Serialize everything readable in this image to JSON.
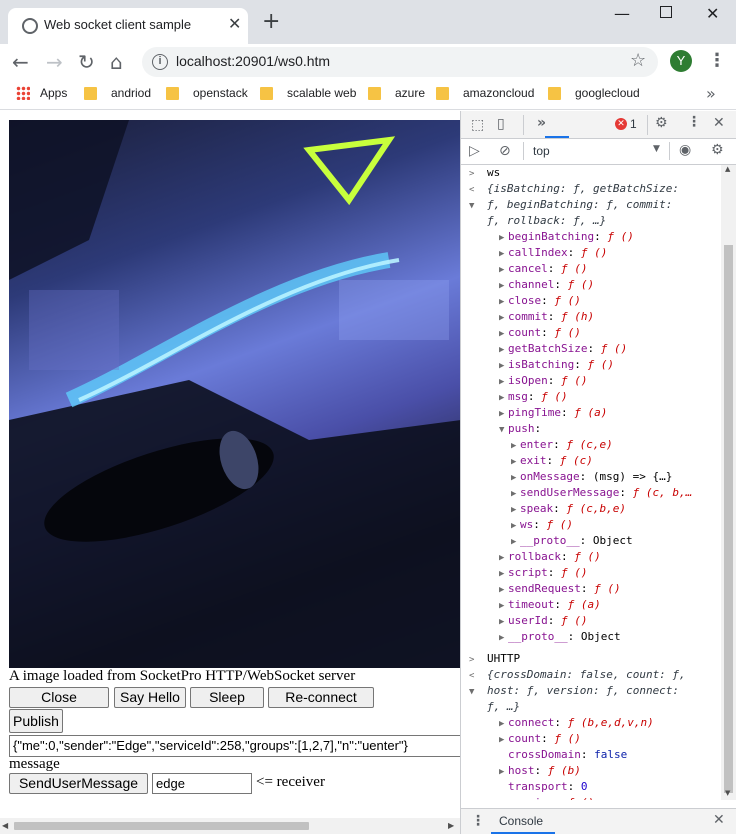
{
  "tab": {
    "title": "Web socket client sample"
  },
  "address": {
    "url": "localhost:20901/ws0.htm"
  },
  "profile": {
    "initial": "Y"
  },
  "bookmarks": [
    {
      "label": "Apps"
    },
    {
      "label": "andriod"
    },
    {
      "label": "openstack"
    },
    {
      "label": "scalable web"
    },
    {
      "label": "azure"
    },
    {
      "label": "amazoncloud"
    },
    {
      "label": "googlecloud"
    }
  ],
  "page": {
    "caption": "A image loaded from SocketPro HTTP/WebSocket server",
    "buttons": {
      "close": "Close",
      "say_hello": "Say Hello",
      "sleep": "Sleep",
      "reconnect": "Re-connect",
      "publish": "Publish",
      "send_user_message": "SendUserMessage"
    },
    "json_value": "{\"me\":0,\"sender\":\"Edge\",\"serviceId\":258,\"groups\":[1,2,7],\"n\":\"uenter\"}",
    "message_label": "message",
    "receiver_value": "edge",
    "receiver_label": "<= receiver"
  },
  "devtools": {
    "error_count": "1",
    "context": "top",
    "drawer_tab": "Console",
    "lines": [
      {
        "d": 0,
        "t": ">",
        "txt": "ws"
      },
      {
        "d": 0,
        "t": "<",
        "txt": "{isBatching: ƒ, getBatchSize:"
      },
      {
        "d": 0,
        "t": "▼",
        "txt": "ƒ, beginBatching: ƒ, commit:"
      },
      {
        "d": 0,
        "t": "",
        "txt": "ƒ, rollback: ƒ, …}"
      },
      {
        "d": 1,
        "t": "▶",
        "k": "beginBatching",
        "v": "ƒ ()"
      },
      {
        "d": 1,
        "t": "▶",
        "k": "callIndex",
        "v": "ƒ ()"
      },
      {
        "d": 1,
        "t": "▶",
        "k": "cancel",
        "v": "ƒ ()"
      },
      {
        "d": 1,
        "t": "▶",
        "k": "channel",
        "v": "ƒ ()"
      },
      {
        "d": 1,
        "t": "▶",
        "k": "close",
        "v": "ƒ ()"
      },
      {
        "d": 1,
        "t": "▶",
        "k": "commit",
        "v": "ƒ (h)"
      },
      {
        "d": 1,
        "t": "▶",
        "k": "count",
        "v": "ƒ ()"
      },
      {
        "d": 1,
        "t": "▶",
        "k": "getBatchSize",
        "v": "ƒ ()"
      },
      {
        "d": 1,
        "t": "▶",
        "k": "isBatching",
        "v": "ƒ ()"
      },
      {
        "d": 1,
        "t": "▶",
        "k": "isOpen",
        "v": "ƒ ()"
      },
      {
        "d": 1,
        "t": "▶",
        "k": "msg",
        "v": "ƒ ()"
      },
      {
        "d": 1,
        "t": "▶",
        "k": "pingTime",
        "v": "ƒ (a)"
      },
      {
        "d": 1,
        "t": "▼",
        "k": "push",
        "v": ""
      },
      {
        "d": 2,
        "t": "▶",
        "k": "enter",
        "v": "ƒ (c,e)"
      },
      {
        "d": 2,
        "t": "▶",
        "k": "exit",
        "v": "ƒ (c)"
      },
      {
        "d": 2,
        "t": "▶",
        "k": "onMessage",
        "v": "(msg) => {…}"
      },
      {
        "d": 2,
        "t": "▶",
        "k": "sendUserMessage",
        "v": "ƒ (c, b,…"
      },
      {
        "d": 2,
        "t": "▶",
        "k": "speak",
        "v": "ƒ (c,b,e)"
      },
      {
        "d": 2,
        "t": "▶",
        "k": "ws",
        "v": "ƒ ()"
      },
      {
        "d": 2,
        "t": "▶",
        "k": "__proto__",
        "v": "Object"
      },
      {
        "d": 1,
        "t": "▶",
        "k": "rollback",
        "v": "ƒ ()"
      },
      {
        "d": 1,
        "t": "▶",
        "k": "script",
        "v": "ƒ ()"
      },
      {
        "d": 1,
        "t": "▶",
        "k": "sendRequest",
        "v": "ƒ ()"
      },
      {
        "d": 1,
        "t": "▶",
        "k": "timeout",
        "v": "ƒ (a)"
      },
      {
        "d": 1,
        "t": "▶",
        "k": "userId",
        "v": "ƒ ()"
      },
      {
        "d": 1,
        "t": "▶",
        "k": "__proto__",
        "v": "Object"
      },
      {
        "d": 0,
        "t": ">",
        "txt": "UHTTP"
      },
      {
        "d": 0,
        "t": "<",
        "txt": "{crossDomain: false, count: ƒ,"
      },
      {
        "d": 0,
        "t": "▼",
        "txt": "host: ƒ, version: ƒ, connect:"
      },
      {
        "d": 0,
        "t": "",
        "txt": "ƒ, …}"
      },
      {
        "d": 1,
        "t": "▶",
        "k": "connect",
        "v": "ƒ (b,e,d,v,n)"
      },
      {
        "d": 1,
        "t": "▶",
        "k": "count",
        "v": "ƒ ()"
      },
      {
        "d": 1,
        "t": "",
        "k": "crossDomain",
        "v": "false"
      },
      {
        "d": 1,
        "t": "▶",
        "k": "host",
        "v": "ƒ (b)"
      },
      {
        "d": 1,
        "t": "",
        "k": "transport",
        "v": "0"
      },
      {
        "d": 1,
        "t": "▶",
        "k": "version",
        "v": "ƒ ()"
      }
    ]
  }
}
